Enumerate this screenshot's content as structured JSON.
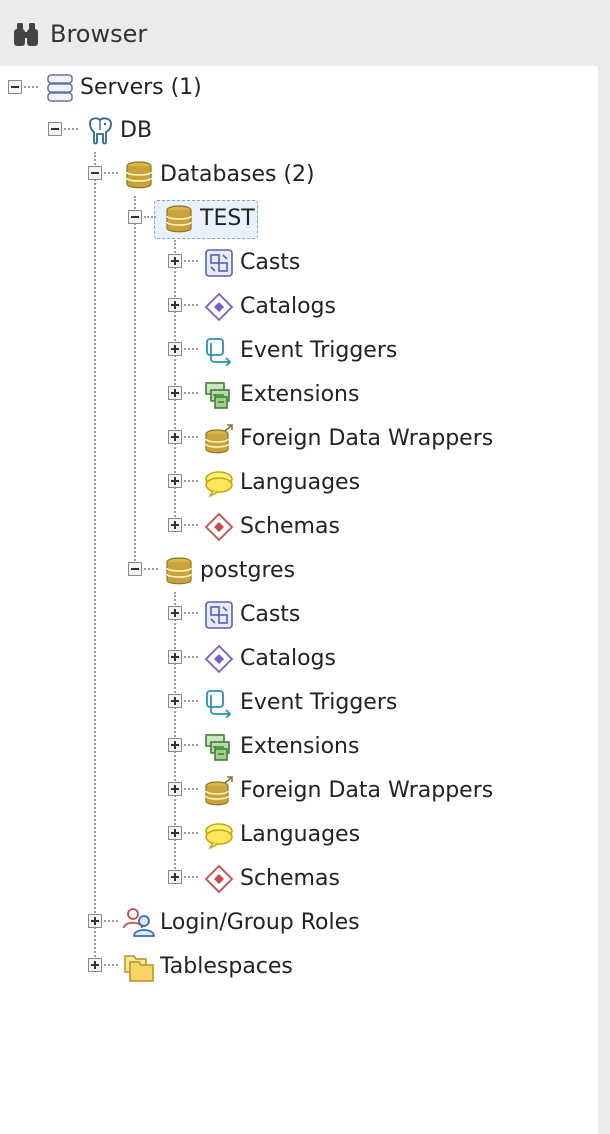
{
  "browser": {
    "title": "Browser",
    "icon": "binoculars-icon"
  },
  "tree": {
    "servers": {
      "label": "Servers (1)",
      "icon": "servers-icon",
      "expanded": true
    },
    "server": {
      "label": "DB",
      "icon": "postgres-elephant-icon",
      "expanded": true
    },
    "databases": {
      "label": "Databases (2)",
      "icon": "databases-icon",
      "expanded": true
    },
    "db_test": {
      "label": "TEST",
      "icon": "database-icon",
      "selected": true,
      "children": [
        {
          "label": "Casts",
          "icon": "casts-icon"
        },
        {
          "label": "Catalogs",
          "icon": "catalogs-icon"
        },
        {
          "label": "Event Triggers",
          "icon": "event-triggers-icon"
        },
        {
          "label": "Extensions",
          "icon": "extensions-icon"
        },
        {
          "label": "Foreign Data Wrappers",
          "icon": "foreign-data-wrappers-icon"
        },
        {
          "label": "Languages",
          "icon": "languages-icon"
        },
        {
          "label": "Schemas",
          "icon": "schemas-icon"
        }
      ]
    },
    "db_postgres": {
      "label": "postgres",
      "icon": "database-icon",
      "children": [
        {
          "label": "Casts",
          "icon": "casts-icon"
        },
        {
          "label": "Catalogs",
          "icon": "catalogs-icon"
        },
        {
          "label": "Event Triggers",
          "icon": "event-triggers-icon"
        },
        {
          "label": "Extensions",
          "icon": "extensions-icon"
        },
        {
          "label": "Foreign Data Wrappers",
          "icon": "foreign-data-wrappers-icon"
        },
        {
          "label": "Languages",
          "icon": "languages-icon"
        },
        {
          "label": "Schemas",
          "icon": "schemas-icon"
        }
      ]
    },
    "login_roles": {
      "label": "Login/Group Roles",
      "icon": "login-group-roles-icon"
    },
    "tablespaces": {
      "label": "Tablespaces",
      "icon": "tablespaces-icon"
    }
  }
}
